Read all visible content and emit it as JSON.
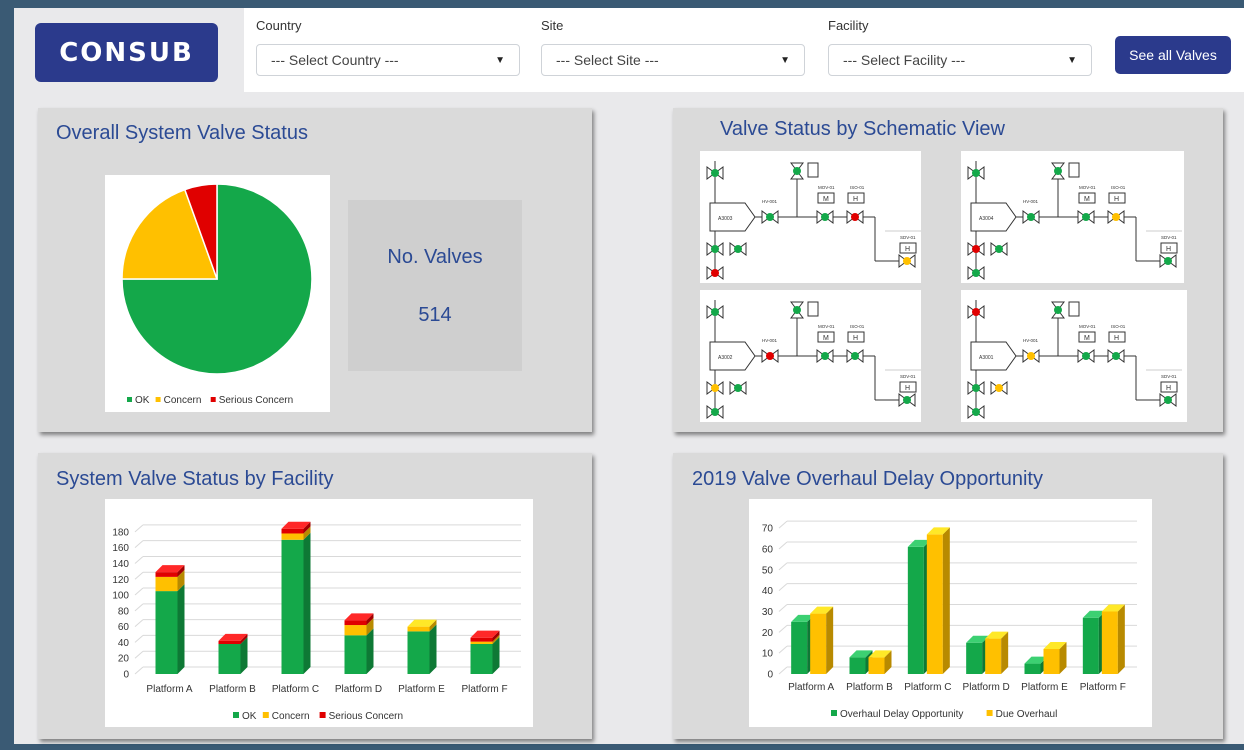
{
  "app": {
    "logo_text": "CONSUB",
    "accent_color": "#2b3a8c"
  },
  "filters": {
    "country": {
      "label": "Country",
      "value": "--- Select Country ---"
    },
    "site": {
      "label": "Site",
      "value": "--- Select Site ---"
    },
    "facility": {
      "label": "Facility",
      "value": "--- Select Facility ---"
    },
    "see_all_label": "See all Valves"
  },
  "panels": {
    "overall": {
      "title": "Overall System Valve Status",
      "kpi_label": "No. Valves",
      "kpi_value": "514"
    },
    "schematic": {
      "title": "Valve Status by Schematic View"
    },
    "facility": {
      "title": "System Valve Status by Facility"
    },
    "overhaul": {
      "title": "2019 Valve Overhaul Delay Opportunity"
    }
  },
  "colors": {
    "ok": "#14a84a",
    "concern": "#ffc000",
    "serious": "#e00000"
  },
  "chart_data": [
    {
      "type": "pie",
      "labels": [
        "OK",
        "Concern",
        "Serious Concern"
      ],
      "values": [
        75,
        19.5,
        5.5
      ],
      "legend": [
        "OK",
        "Concern",
        "Serious Concern"
      ],
      "legend_position": "bottom"
    },
    {
      "type": "bar",
      "stacked": true,
      "categories": [
        "Platform A",
        "Platform B",
        "Platform C",
        "Platform D",
        "Platform E",
        "Platform F"
      ],
      "series": [
        {
          "name": "OK",
          "values": [
            105,
            38,
            170,
            49,
            54,
            38
          ]
        },
        {
          "name": "Concern",
          "values": [
            18,
            0,
            8,
            13,
            6,
            3
          ]
        },
        {
          "name": "Serious Concern",
          "values": [
            6,
            4,
            6,
            6,
            0,
            5
          ]
        }
      ],
      "yticks": [
        "0",
        "20",
        "40",
        "60",
        "80",
        "100",
        "120",
        "140",
        "160",
        "180"
      ],
      "ylim": [
        0,
        190
      ],
      "legend_position": "bottom"
    },
    {
      "type": "bar",
      "categories": [
        "Platform A",
        "Platform B",
        "Platform C",
        "Platform D",
        "Platform E",
        "Platform F"
      ],
      "series": [
        {
          "name": "Overhaul Delay Opportunity",
          "values": [
            25,
            8,
            61,
            15,
            5,
            27
          ]
        },
        {
          "name": "Due Overhaul",
          "values": [
            29,
            8,
            67,
            17,
            12,
            30
          ]
        }
      ],
      "yticks": [
        "0",
        "10",
        "20",
        "30",
        "40",
        "50",
        "60",
        "70"
      ],
      "ylim": [
        0,
        72
      ],
      "legend_position": "bottom"
    }
  ],
  "schematics": {
    "tags": [
      "A3003",
      "A3004",
      "A3002",
      "A3001"
    ],
    "valve_labels": [
      "HV-001",
      "MOV-01",
      "ISO-01",
      "SDV-01"
    ],
    "schematic_states": [
      [
        "green",
        "green",
        "red",
        "green",
        "green",
        "green",
        "green",
        "red",
        "green",
        "yellow"
      ],
      [
        "green",
        "red",
        "green",
        "green",
        "green",
        "green",
        "green",
        "yellow",
        "green",
        "green"
      ],
      [
        "green",
        "yellow",
        "green",
        "green",
        "green",
        "red",
        "green",
        "green",
        "green",
        "green"
      ],
      [
        "red",
        "green",
        "green",
        "yellow",
        "green",
        "yellow",
        "green",
        "green",
        "green",
        "green"
      ]
    ]
  }
}
